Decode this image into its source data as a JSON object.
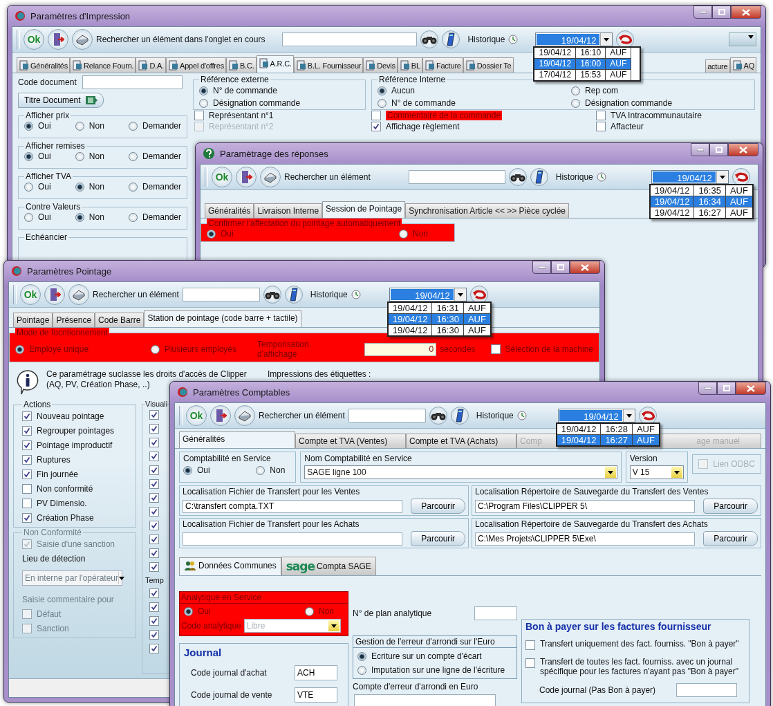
{
  "impression": {
    "title": "Paramètres d'Impression",
    "toolbar": {
      "ok": "Ok",
      "search_label": "Rechercher un élément dans l'onglet en cours",
      "history_label": "Historique",
      "date": "19/04/12",
      "history": [
        {
          "date": "19/04/12",
          "time": "16:10",
          "user": "AUF",
          "selected": false
        },
        {
          "date": "19/04/12",
          "time": "16:00",
          "user": "AUF",
          "selected": true
        },
        {
          "date": "17/04/12",
          "time": "15:53",
          "user": "AUF",
          "selected": false
        }
      ]
    },
    "tabs": [
      {
        "label": "Généralités",
        "selected": false
      },
      {
        "label": "Relance Fourn.",
        "selected": false
      },
      {
        "label": "D.A.",
        "selected": false
      },
      {
        "label": "Appel d'offres",
        "selected": false
      },
      {
        "label": "B.C.",
        "selected": false
      },
      {
        "label": "A.R.C.",
        "selected": true
      },
      {
        "label": "B.L. Fournisseur",
        "selected": false
      },
      {
        "label": "Devis",
        "selected": false
      },
      {
        "label": "BL",
        "selected": false
      },
      {
        "label": "Facture",
        "selected": false
      },
      {
        "label": "Dossier Te",
        "selected": false
      },
      {
        "label": "acture",
        "selected": false
      },
      {
        "label": "AQ",
        "selected": false
      }
    ],
    "code_document_label": "Code document",
    "title_button": "Titre Document",
    "radio_groups": [
      {
        "legend": "Afficher prix",
        "options": [
          {
            "label": "Oui",
            "selected": true
          },
          {
            "label": "Non",
            "selected": false
          },
          {
            "label": "Demander",
            "selected": false
          }
        ]
      },
      {
        "legend": "Afficher remises",
        "options": [
          {
            "label": "Oui",
            "selected": true
          },
          {
            "label": "Non",
            "selected": false
          },
          {
            "label": "Demander",
            "selected": false
          }
        ]
      },
      {
        "legend": "Afficher TVA",
        "options": [
          {
            "label": "Oui",
            "selected": false
          },
          {
            "label": "Non",
            "selected": true
          },
          {
            "label": "Demander",
            "selected": false
          }
        ]
      },
      {
        "legend": "Contre Valeurs",
        "options": [
          {
            "label": "Oui",
            "selected": false
          },
          {
            "label": "Non",
            "selected": true
          },
          {
            "label": "Demander",
            "selected": false
          }
        ]
      }
    ],
    "schedule_legend": "Echéancier",
    "reference_externe": {
      "legend": "Référence externe",
      "options": [
        {
          "label": "N° de commande",
          "selected": true
        },
        {
          "label": "Désignation commande",
          "selected": false
        }
      ]
    },
    "reference_interne": {
      "legend": "Référence Interne",
      "options": [
        {
          "label": "Aucun",
          "selected": true
        },
        {
          "label": "Rep com",
          "selected": false
        },
        {
          "label": "N° de commande",
          "selected": false
        },
        {
          "label": "Désignation commande",
          "selected": false
        }
      ]
    },
    "checks_left": [
      {
        "label": "Représentant n°1",
        "checked": false,
        "disabled": false
      },
      {
        "label": "Représentant n°2",
        "checked": false,
        "disabled": true
      }
    ],
    "checks_right": [
      {
        "label": "Commentaire de la commande",
        "checked": false,
        "highlighted": true
      },
      {
        "label": "TVA Intracommunautaire",
        "checked": false,
        "highlighted": false
      },
      {
        "label": "Affichage règlement",
        "checked": true,
        "highlighted": false
      },
      {
        "label": "Affacteur",
        "checked": false,
        "highlighted": false
      }
    ]
  },
  "reponses": {
    "title": "Paramètrage des réponses",
    "toolbar": {
      "ok": "Ok",
      "search_label": "Rechercher un élément",
      "history_label": "Historique",
      "date": "19/04/12",
      "history": [
        {
          "date": "19/04/12",
          "time": "16:35",
          "user": "AUF",
          "selected": false
        },
        {
          "date": "19/04/12",
          "time": "16:34",
          "user": "AUF",
          "selected": true
        },
        {
          "date": "19/04/12",
          "time": "16:27",
          "user": "AUF",
          "selected": false
        }
      ]
    },
    "tabs": [
      {
        "label": "Généralités",
        "selected": false
      },
      {
        "label": "Livraison Interne",
        "selected": false
      },
      {
        "label": "Session de Pointage",
        "selected": true
      },
      {
        "label": "Synchronisation Article << >> Pièce cyclée",
        "selected": false
      }
    ],
    "confirm": {
      "legend": "Confirmer l'affectation du pointage automatiquement",
      "options": [
        {
          "label": "Oui",
          "selected": true
        },
        {
          "label": "Non",
          "selected": false
        }
      ]
    }
  },
  "pointage": {
    "title": "Paramètres Pointage",
    "toolbar": {
      "ok": "Ok",
      "search_label": "Rechercher un élément",
      "history_label": "Historique",
      "date": "19/04/12",
      "history": [
        {
          "date": "19/04/12",
          "time": "16:31",
          "user": "AUF",
          "selected": false
        },
        {
          "date": "19/04/12",
          "time": "16:30",
          "user": "AUF",
          "selected": true
        },
        {
          "date": "19/04/12",
          "time": "16:30",
          "user": "AUF",
          "selected": false
        }
      ]
    },
    "tabs": [
      {
        "label": "Pointage",
        "selected": false
      },
      {
        "label": "Présence",
        "selected": false
      },
      {
        "label": "Code Barre",
        "selected": false
      },
      {
        "label": "Station de pointage (code barre + tactile)",
        "selected": true
      }
    ],
    "mode": {
      "legend": "Mode de focntionnement",
      "options": [
        {
          "label": "Employé unique",
          "selected": true
        },
        {
          "label": "Plusieurs employés",
          "selected": false
        }
      ],
      "delay_label": "Temporisation d'affichage",
      "delay_value": "0",
      "delay_unit": "secondes",
      "machine": {
        "label": "Sélection de la machine",
        "checked": false
      }
    },
    "info": "Ce paramétrage suclasse les droits d'accès de Clipper\n(AQ, PV, Création Phase, ..)",
    "labels_title": "Impressions des étiquettes :",
    "actions": {
      "legend": "Actions",
      "items": [
        {
          "label": "Nouveau pointage",
          "checked": true
        },
        {
          "label": "Regrouper pointages",
          "checked": true
        },
        {
          "label": "Pointage improductif",
          "checked": true
        },
        {
          "label": "Ruptures",
          "checked": true
        },
        {
          "label": "Fin journée",
          "checked": true
        },
        {
          "label": "Non conformité",
          "checked": false
        },
        {
          "label": "PV Dimensio.",
          "checked": false
        },
        {
          "label": "Création Phase",
          "checked": true
        }
      ]
    },
    "visual": {
      "legend": "Visuali",
      "items": [
        {
          "checked": true
        },
        {
          "checked": true
        },
        {
          "checked": true
        },
        {
          "checked": true
        },
        {
          "checked": true
        },
        {
          "checked": true
        },
        {
          "checked": true
        },
        {
          "checked": true
        },
        {
          "checked": true
        },
        {
          "checked": true
        },
        {
          "checked": true
        },
        {
          "checked": true
        }
      ],
      "sublabel": "Temp",
      "subitems": [
        {
          "checked": true
        },
        {
          "checked": true
        },
        {
          "checked": true
        },
        {
          "checked": true
        },
        {
          "checked": true
        }
      ]
    },
    "non_conformite": {
      "legend": "Non Conformité",
      "disabled": true,
      "sanction": {
        "label": "Saisie d'une sanction",
        "checked": true
      },
      "lieu_label": "Lieu de détection",
      "lieu_value": "En interne par l'opérateur",
      "comment_label": "Saisie commentaire pour",
      "comment_items": [
        {
          "label": "Défaut",
          "checked": false
        },
        {
          "label": "Sanction",
          "checked": false
        }
      ]
    }
  },
  "comptables": {
    "title": "Paramètres Comptables",
    "toolbar": {
      "ok": "Ok",
      "search_label": "Rechercher un élément",
      "history_label": "Historique",
      "date": "19/04/12",
      "history": [
        {
          "date": "19/04/12",
          "time": "16:28",
          "user": "AUF",
          "selected": false
        },
        {
          "date": "19/04/12",
          "time": "16:27",
          "user": "AUF",
          "selected": true
        }
      ]
    },
    "tabs": [
      {
        "label": "Généralités",
        "selected": true,
        "disabled": false
      },
      {
        "label": "Compte et TVA (Ventes)",
        "selected": false,
        "disabled": false
      },
      {
        "label": "Compte et TVA (Achats)",
        "selected": false,
        "disabled": false
      },
      {
        "label": "Comp",
        "selected": false,
        "disabled": true
      },
      {
        "label": "age manuel",
        "selected": false,
        "disabled": true
      }
    ],
    "service": {
      "label": "Comptabilité en Service",
      "options": [
        {
          "label": "Oui",
          "selected": true
        },
        {
          "label": "Non",
          "selected": false
        }
      ]
    },
    "software": {
      "label": "Nom Comptabilité en Service",
      "value": "SAGE ligne 100"
    },
    "version": {
      "label": "Version",
      "value": "V 15"
    },
    "odbc": {
      "label": "Lien ODBC",
      "checked": false,
      "disabled": true
    },
    "locations": [
      {
        "label": "Localisation Fichier de Transfert pour les Ventes",
        "value": "C:\\transfert compta.TXT",
        "button": "Parcourir"
      },
      {
        "label": "Localisation Répertoire de Sauvegarde du Transfert des Ventes",
        "value": "C:\\Program Files\\CLIPPER 5\\",
        "button": "Parcourir"
      },
      {
        "label": "Localisation Fichier de Transfert pour les Achats",
        "button": "Parcourir"
      },
      {
        "label": "Localisation Répertoire de Sauvegarde du Transfert des Achats",
        "value": "C:\\Mes Projets\\CLIPPER 5\\Exe\\",
        "button": "Parcourir"
      }
    ],
    "subtabs": [
      {
        "label": "Données Communes",
        "selected": true,
        "kind": "people"
      },
      {
        "label": "Compta SAGE",
        "selected": false,
        "kind": "sage",
        "logo": "sage"
      }
    ],
    "analytique": {
      "legend": "Analytique en Service",
      "options": [
        {
          "label": "Oui",
          "selected": true
        },
        {
          "label": "Non",
          "selected": false
        }
      ],
      "code_label": "Code analytique",
      "code_value": "Libre",
      "code_disabled": true
    },
    "plan_label": "N° de plan analytique",
    "journal": {
      "title": "Journal",
      "rows": [
        {
          "label": "Code journal d'achat",
          "value": "ACH"
        },
        {
          "label": "Code journal de vente",
          "value": "VTE"
        }
      ]
    },
    "rounding": {
      "legend": "Gestion de l'erreur d'arrondi sur l'Euro",
      "options": [
        {
          "label": "Ecriture sur un compte d'écart",
          "selected": true
        },
        {
          "label": "Imputation sur une ligne de l'écriture",
          "selected": false
        }
      ]
    },
    "rounding_account_label": "Compte d'erreur d'arrondi en Euro",
    "bon": {
      "title": "Bon à payer sur les factures fournisseur",
      "items": [
        {
          "label": "Transfert uniquement des fact. fourniss. \"Bon à payer\"",
          "checked": false
        },
        {
          "label": "Transfert de toutes les fact. fourniss. avec un journal spécifique pour les factures n'ayant pas \"Bon à payer\"",
          "checked": false
        }
      ],
      "code_label": "Code journal (Pas Bon à payer)"
    }
  }
}
